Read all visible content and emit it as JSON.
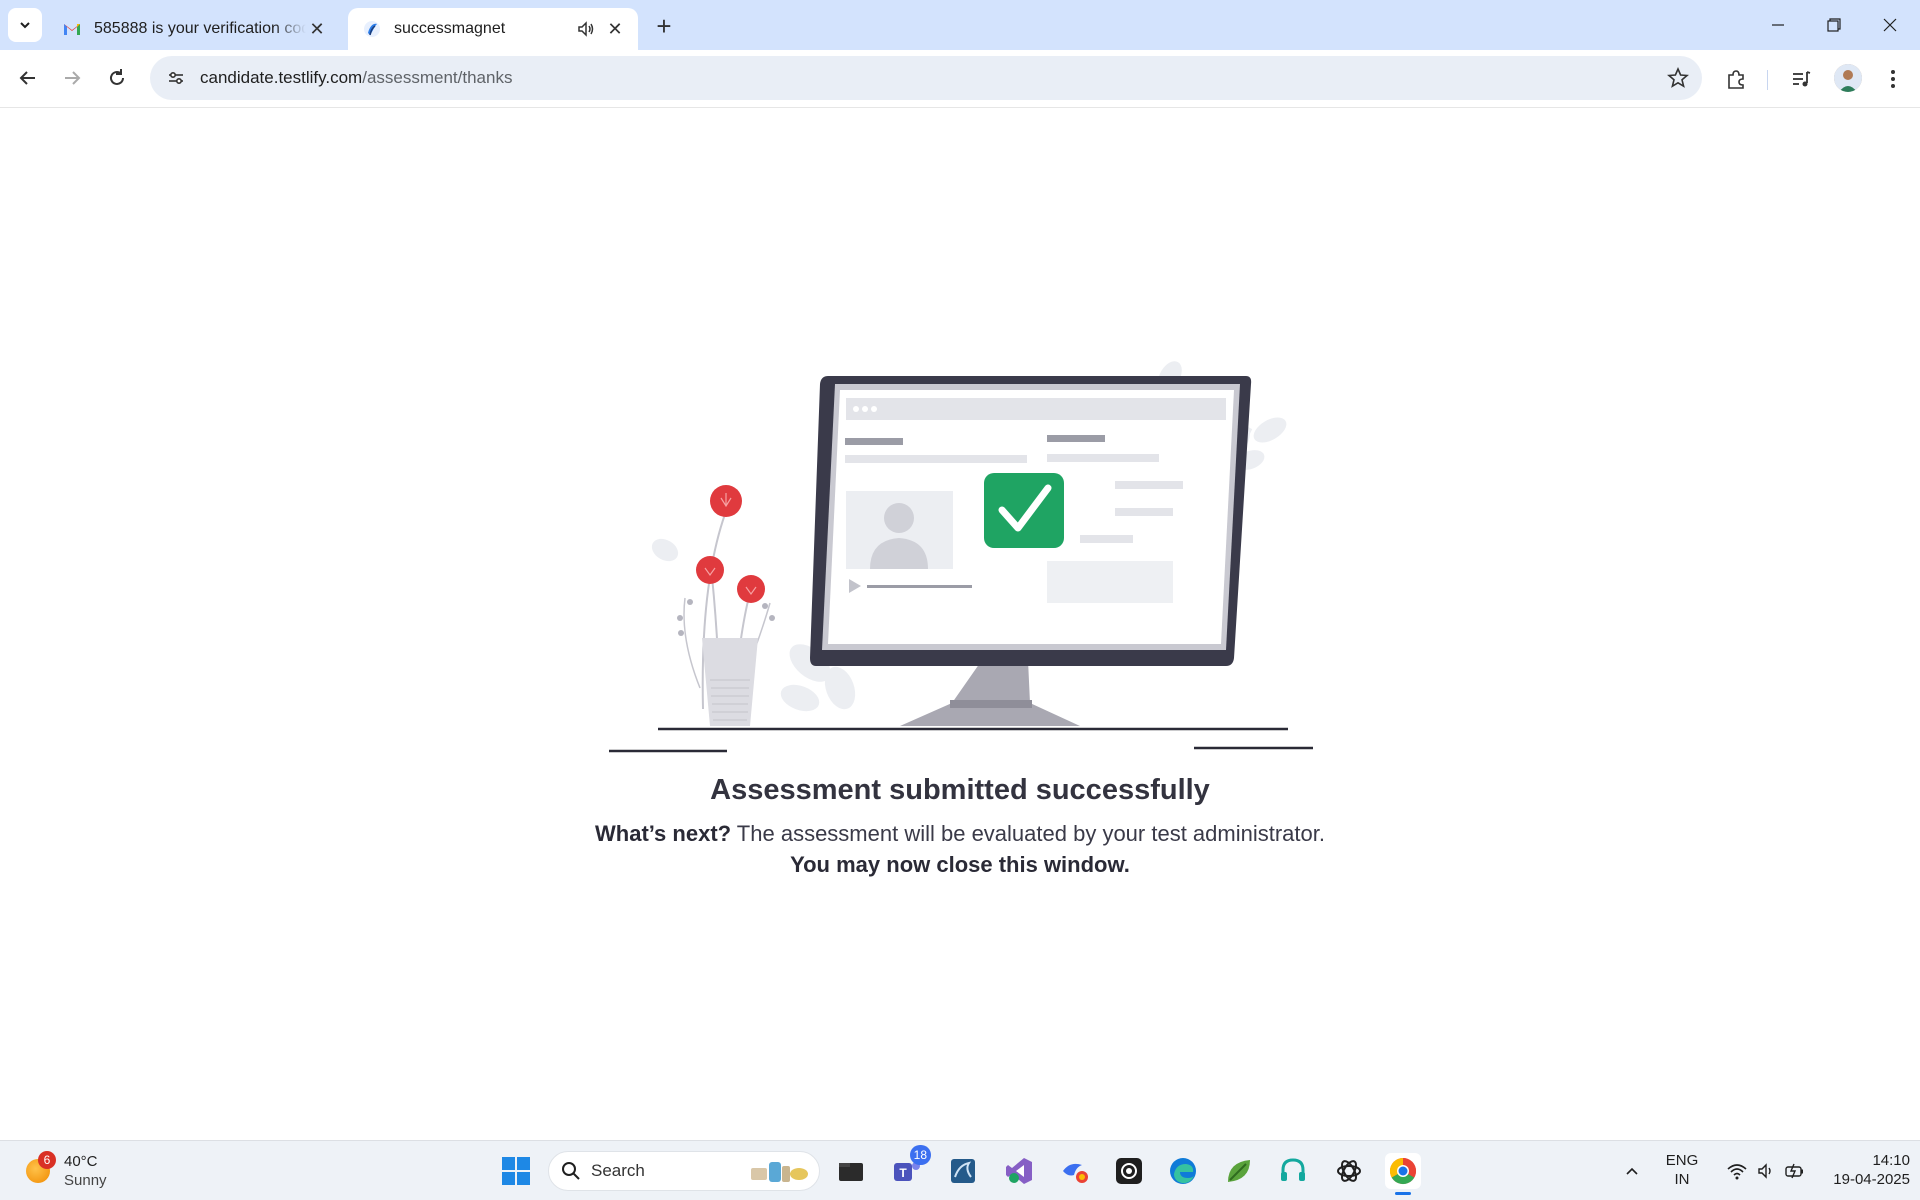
{
  "browser": {
    "tabs": [
      {
        "title": "585888 is your verification code",
        "favicon": "gmail-icon",
        "active": false
      },
      {
        "title": "successmagnet",
        "favicon": "testlify-icon",
        "active": true,
        "audio": true
      }
    ],
    "address_bar": {
      "host": "candidate.testlify.com",
      "path": "/assessment/thanks"
    }
  },
  "page": {
    "heading": "Assessment submitted successfully",
    "whats_next_label": "What’s next?",
    "whats_next_text": " The assessment will be evaluated by your test administrator.",
    "close_note": "You may now close this window."
  },
  "taskbar": {
    "weather": {
      "badge": "6",
      "temp": "40°C",
      "condition": "Sunny"
    },
    "search_placeholder": "Search",
    "teams_badge": "18",
    "language": {
      "line1": "ENG",
      "line2": "IN"
    },
    "clock": {
      "time": "14:10",
      "date": "19-04-2025"
    }
  },
  "colors": {
    "tabstrip": "#d3e3fd",
    "accent_green": "#1fa463",
    "flower_red": "#e03a3e"
  }
}
